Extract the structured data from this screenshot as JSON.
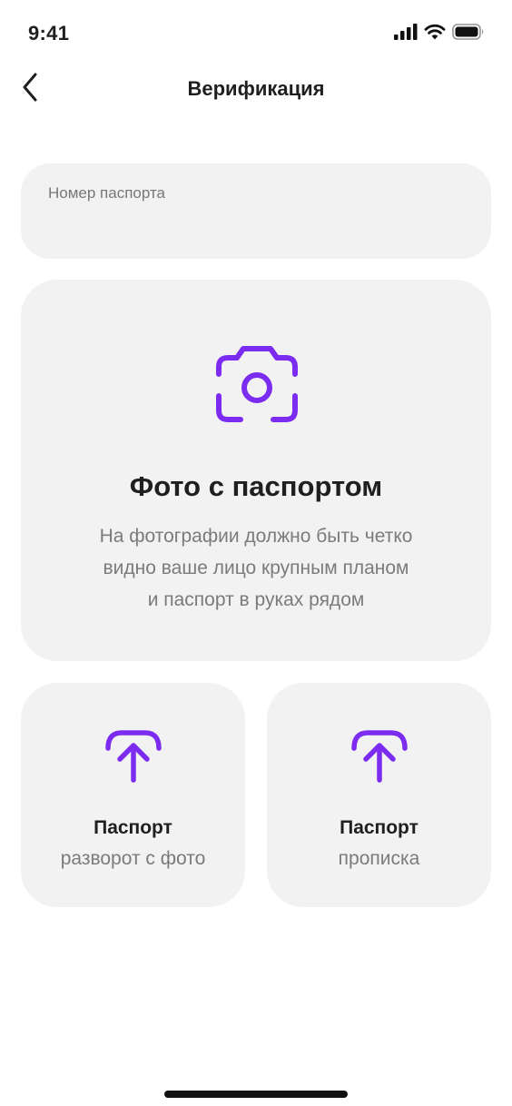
{
  "status_bar": {
    "time": "9:41",
    "icons": [
      "signal-icon",
      "wifi-icon",
      "battery-icon"
    ]
  },
  "header": {
    "title": "Верификация",
    "back_icon": "chevron-left-icon"
  },
  "passport_field": {
    "label": "Номер паспорта",
    "value": ""
  },
  "photo_card": {
    "icon": "camera-icon",
    "title": "Фото с паспортом",
    "description_lines": [
      "На фотографии должно быть четко",
      "видно ваше лицо крупным планом",
      "и паспорт в руках рядом"
    ]
  },
  "upload_cards": [
    {
      "icon": "upload-icon",
      "title": "Паспорт",
      "subtitle": "разворот с фото"
    },
    {
      "icon": "upload-icon",
      "title": "Паспорт",
      "subtitle": "прописка"
    }
  ],
  "colors": {
    "accent": "#7b2cf0",
    "card_background": "#f2f2f2",
    "text_primary": "#1f1f1f",
    "text_secondary": "#7b7b7b"
  }
}
